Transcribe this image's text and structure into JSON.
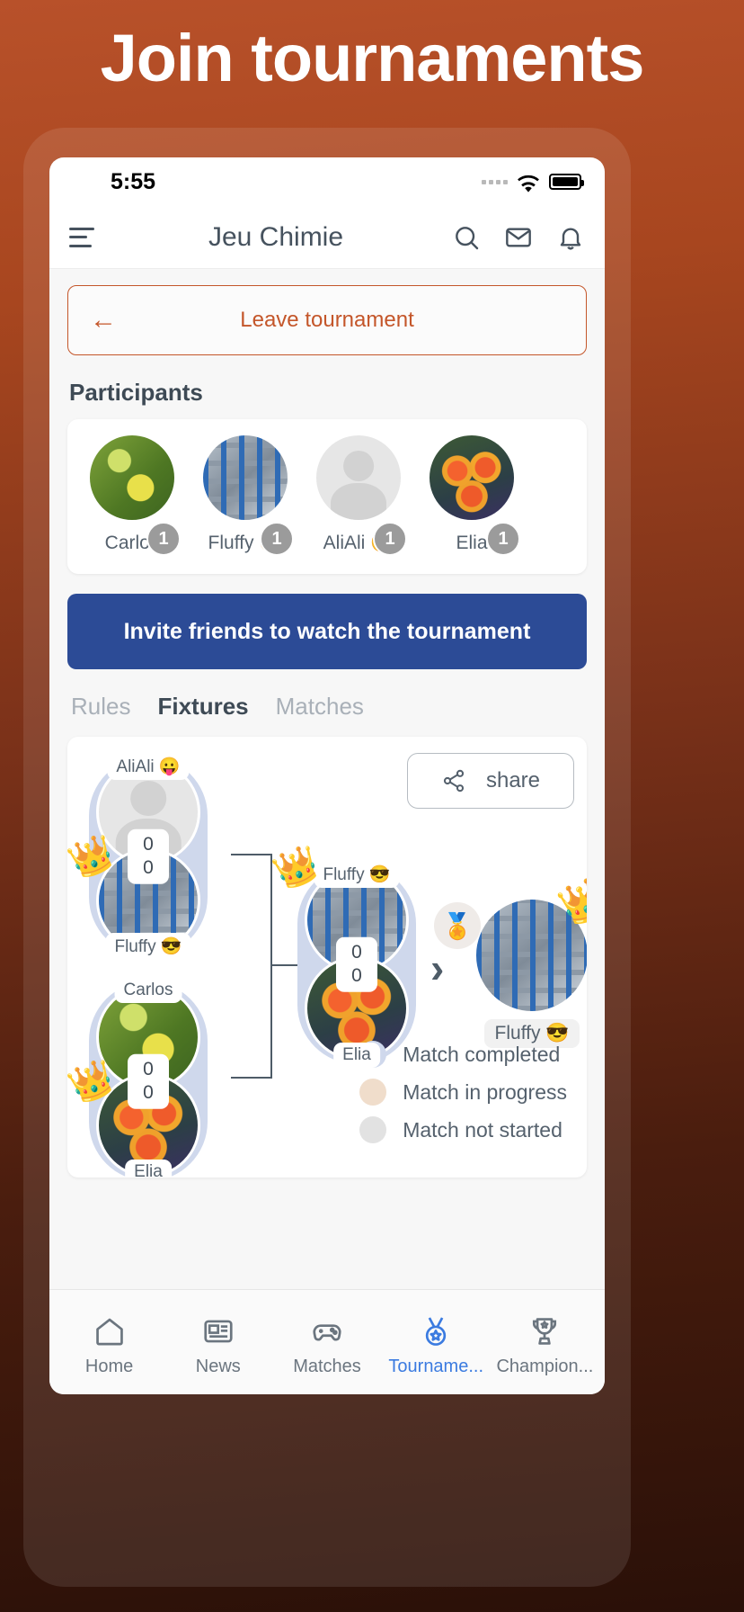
{
  "promo": {
    "headline": "Join tournaments"
  },
  "status_bar": {
    "time": "5:55",
    "wifi_icon": "wifi-icon",
    "battery_icon": "battery-icon",
    "signal_icon": "signal-dots-icon"
  },
  "app_header": {
    "menu_icon": "hamburger-menu-icon",
    "title": "Jeu Chimie",
    "search_icon": "search-icon",
    "mail_icon": "mail-icon",
    "bell_icon": "bell-icon"
  },
  "leave_tournament": {
    "label": "Leave tournament",
    "back_icon": "arrow-left-icon",
    "color": "#c4562a"
  },
  "participants_section": {
    "title": "Participants",
    "items": [
      {
        "name": "Carlos",
        "badge": "1",
        "avatar": "leaf-photo"
      },
      {
        "name": "Fluffy 😎",
        "badge": "1",
        "avatar": "collage-photo"
      },
      {
        "name": "AliAli 😛",
        "badge": "1",
        "avatar": "default-person-avatar"
      },
      {
        "name": "Elia",
        "badge": "1",
        "avatar": "flower-photo"
      }
    ]
  },
  "invite_button": {
    "label": "Invite friends to watch the tournament",
    "color": "#2c4b96"
  },
  "tabs": [
    {
      "label": "Rules",
      "active": false
    },
    {
      "label": "Fixtures",
      "active": true
    },
    {
      "label": "Matches",
      "active": false
    }
  ],
  "bracket": {
    "share_button": {
      "label": "share",
      "icon": "share-icon"
    },
    "match_color_completed": "#cfd8ec",
    "round1": [
      {
        "top": {
          "name": "AliAli 😛",
          "score": "0",
          "avatar": "default-person-avatar",
          "winner": false
        },
        "bottom": {
          "name": "Fluffy 😎",
          "score": "0",
          "avatar": "collage-photo",
          "winner": true
        }
      },
      {
        "top": {
          "name": "Carlos",
          "score": "0",
          "avatar": "leaf-photo",
          "winner": false
        },
        "bottom": {
          "name": "Elia",
          "score": "0",
          "avatar": "flower-photo",
          "winner": true
        }
      }
    ],
    "round2": [
      {
        "top": {
          "name": "Fluffy 😎",
          "score": "0",
          "avatar": "collage-photo",
          "winner": true
        },
        "bottom": {
          "name": "Elia",
          "score": "0",
          "avatar": "flower-photo",
          "winner": false
        }
      }
    ],
    "winner": {
      "name": "Fluffy 😎",
      "avatar": "collage-photo",
      "medal_icon": "medal-icon",
      "crown_icon": "crown-icon",
      "arrow": "›"
    },
    "legend": [
      {
        "label": "Match completed",
        "color": "#cfd8ec"
      },
      {
        "label": "Match in progress",
        "color": "#f0ddcb"
      },
      {
        "label": "Match not started",
        "color": "#e2e2e2"
      }
    ]
  },
  "bottom_nav": [
    {
      "label": "Home",
      "icon": "home-icon",
      "active": false
    },
    {
      "label": "News",
      "icon": "news-icon",
      "active": false
    },
    {
      "label": "Matches",
      "icon": "gamepad-icon",
      "active": false
    },
    {
      "label": "Tourname...",
      "icon": "medal-icon",
      "active": true
    },
    {
      "label": "Champion...",
      "icon": "trophy-icon",
      "active": false
    }
  ]
}
